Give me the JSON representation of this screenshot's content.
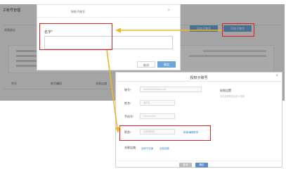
{
  "background": {
    "title": "子账号管理",
    "tab": "权限部分",
    "buttons": [
      "添加子账号",
      "添加子账号"
    ],
    "table_headers": [
      "序号",
      "账号编码",
      "关联店铺"
    ]
  },
  "small_modal": {
    "title": "授权子账号",
    "close": "×",
    "field_label": "名字",
    "required_mark": "*",
    "field_value": "",
    "cancel": "取消",
    "ok": "确定"
  },
  "big_modal": {
    "title": "授权子账号",
    "close": "×",
    "fields": [
      {
        "label": "账号",
        "value": "xxxxxxxxxxxxxxxx.com"
      },
      {
        "label": "姓名",
        "value": "测试名"
      },
      {
        "label": "手机号",
        "value": "1xxxxxxxxxx"
      },
      {
        "label": "职务",
        "value": "请选择职务"
      }
    ],
    "required_mark": "*",
    "position_link": "新增/编辑职务",
    "shops_label": "关联店铺",
    "shop_links": [
      "全部子店铺",
      "全部店铺"
    ],
    "side_title": "权限设置",
    "side_text": "请先选择职务后进行设置",
    "cancel": "取消",
    "ok": "确定"
  },
  "colors": {
    "highlight": "#d9201c",
    "arrow": "#f0b528",
    "primary": "#6aa6d8"
  }
}
